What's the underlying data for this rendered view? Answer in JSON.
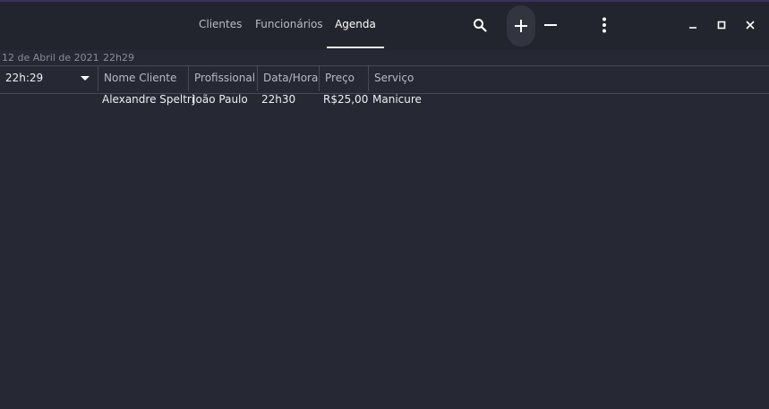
{
  "header": {
    "tabs": [
      {
        "label": "Clientes"
      },
      {
        "label": "Funcionários"
      },
      {
        "label": "Agenda"
      }
    ]
  },
  "icons": [
    "search-icon",
    "add-icon",
    "remove-icon",
    "more-icon",
    "minimize-icon",
    "maximize-icon",
    "close-icon"
  ],
  "subheader": {
    "date": "12 de Abril de 2021",
    "time": "22h29"
  },
  "filter": {
    "selected": "22h:29"
  },
  "table": {
    "columns": [
      "Nome Cliente",
      "Profissional",
      "Data/Hora",
      "Preço",
      "Serviço"
    ],
    "rows": [
      [
        "Alexandre Speltri",
        "João Paulo",
        "22h30",
        "R$25,00",
        "Manicure"
      ]
    ]
  }
}
